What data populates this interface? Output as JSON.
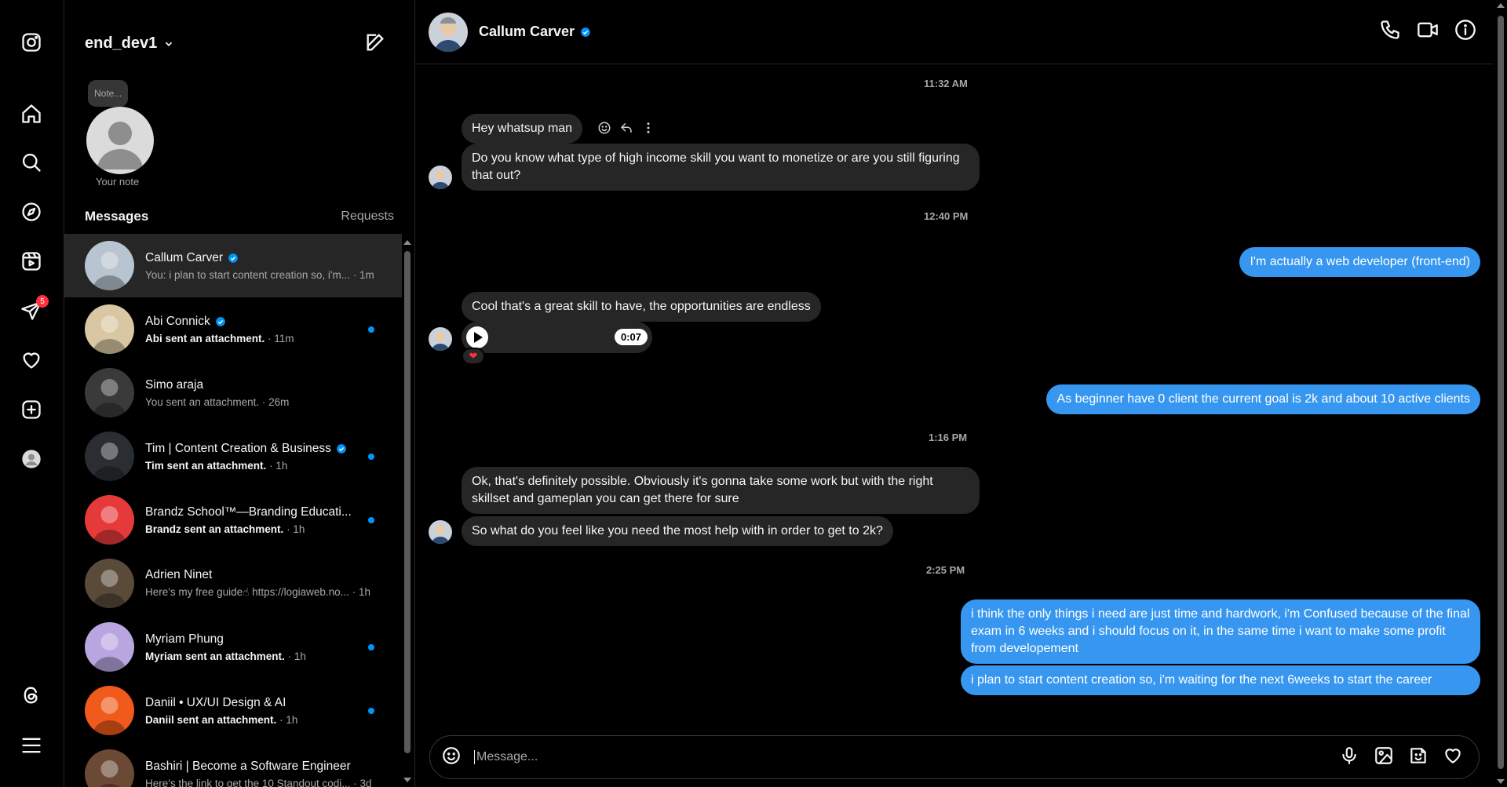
{
  "account": {
    "username": "end_dev1"
  },
  "notes": {
    "bubble": "Note...",
    "label": "Your note"
  },
  "sidebar": {
    "nav": [
      "instagram-logo",
      "home",
      "search",
      "explore",
      "reels",
      "messages",
      "notifications",
      "create",
      "profile",
      "threads",
      "more"
    ],
    "messages_badge": "5"
  },
  "list": {
    "title": "Messages",
    "requests_label": "Requests",
    "conversations": [
      {
        "name": "Callum Carver",
        "verified": true,
        "preview": "You: i plan to start content creation so, i'm...",
        "time": "· 1m",
        "unread": false,
        "active": true,
        "avatar_color": "#b8c4d0"
      },
      {
        "name": "Abi Connick",
        "verified": true,
        "preview": "Abi sent an attachment.",
        "time": "· 11m",
        "unread": true,
        "active": false,
        "avatar_color": "#d9c7a4"
      },
      {
        "name": "Simo araja",
        "verified": false,
        "preview": "You sent an attachment.",
        "time": "· 26m",
        "unread": false,
        "active": false,
        "avatar_color": "#3a3a3a"
      },
      {
        "name": "Tim | Content Creation & Business",
        "verified": true,
        "preview": "Tim sent an attachment.",
        "time": "· 1h",
        "unread": true,
        "active": false,
        "avatar_color": "#2a2e33"
      },
      {
        "name": "Brandz School™—Branding Educati...",
        "verified": false,
        "preview": "Brandz sent an attachment.",
        "time": "· 1h",
        "unread": true,
        "active": false,
        "avatar_color": "#e63a3a"
      },
      {
        "name": "Adrien Ninet",
        "verified": false,
        "preview": "Here's my free guide☝ https://logiaweb.no...",
        "time": "· 1h",
        "unread": false,
        "active": false,
        "avatar_color": "#5a4a3a"
      },
      {
        "name": "Myriam Phung",
        "verified": false,
        "preview": "Myriam sent an attachment.",
        "time": "· 1h",
        "unread": true,
        "active": false,
        "avatar_color": "#b9a6e0"
      },
      {
        "name": "Daniil • UX/UI Design & AI",
        "verified": false,
        "preview": "Daniil sent an attachment.",
        "time": "· 1h",
        "unread": true,
        "active": false,
        "avatar_color": "#f05a1a"
      },
      {
        "name": "Bashiri | Become a Software Engineer",
        "verified": false,
        "preview": "Here's the link to get the 10 Standout codi...",
        "time": "· 3d",
        "unread": false,
        "active": false,
        "avatar_color": "#6a4a35"
      }
    ]
  },
  "chat": {
    "contact_name": "Callum Carver",
    "verified": true,
    "timestamps": [
      "11:32 AM",
      "12:40 PM",
      "1:16 PM",
      "2:25 PM"
    ],
    "messages": {
      "m1": "Hey whatsup man",
      "m2": "Do you know what type of high income skill you want to monetize or are you still figuring that out?",
      "m3": "I'm actually a web developer (front-end)",
      "m4": "Cool that's a great skill to have, the opportunities are endless",
      "voice_duration": "0:07",
      "reaction": "❤",
      "m5": "As beginner have 0 client the current goal is 2k and about 10 active clients",
      "m6": "Ok, that's definitely possible. Obviously it's gonna take some work but with the right skillset and gameplan you can get there for sure",
      "m7": "So what do you feel like you need the most help with in order to get to 2k?",
      "m8": "i think the only things i need are just time and hardwork, i'm Confused because of the final exam in 6 weeks and i should focus on it, in the same time i want to make some profit from developement",
      "m9": "i plan to start content creation so, i'm waiting for the next 6weeks to start the career"
    },
    "composer": {
      "placeholder": "Message..."
    }
  }
}
